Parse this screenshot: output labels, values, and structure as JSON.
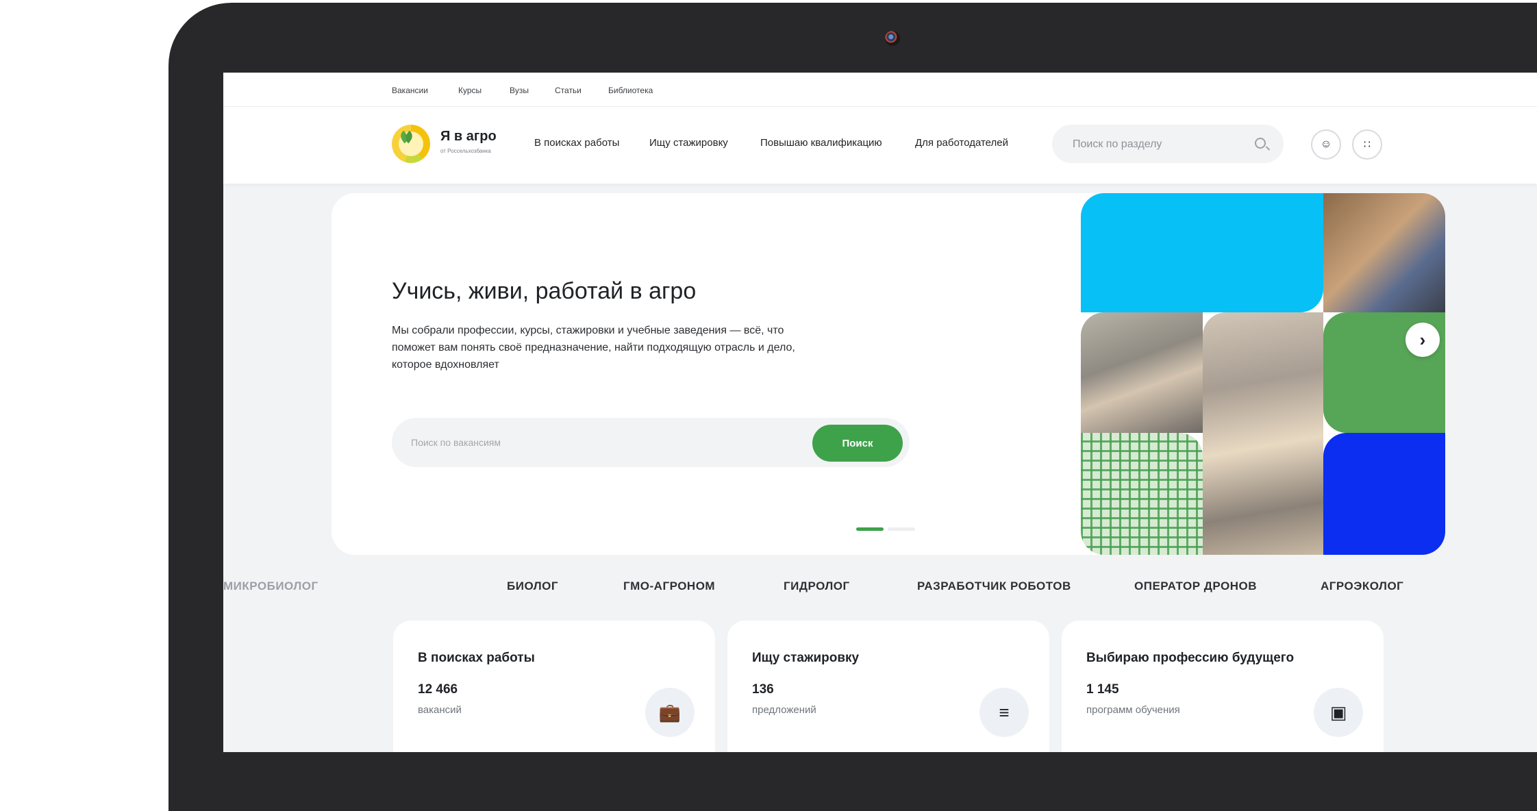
{
  "top_nav": [
    "Вакансии",
    "Курсы",
    "Вузы",
    "Статьи",
    "Библиотека"
  ],
  "brand": {
    "title": "Я в агро",
    "subtitle": "от Россельхозбанка"
  },
  "main_nav": [
    "В поисках работы",
    "Ищу стажировку",
    "Повышаю квалификацию",
    "Для работодателей"
  ],
  "header_search": {
    "placeholder": "Поиск по разделу"
  },
  "hero": {
    "title": "Учись, живи, работай в агро",
    "description": "Мы собрали профессии, курсы, стажировки и учебные заведения — всё, что поможет вам понять своё предназначение, найти подходящую отрасль и дело, которое вдохновляет",
    "search_placeholder": "Поиск по вакансиям",
    "search_button": "Поиск",
    "slides_total": 2,
    "slide_active": 1
  },
  "professions": [
    "МИКРОБИОЛОГ",
    "БИОЛОГ",
    "ГМО-АГРОНОМ",
    "ГИДРОЛОГ",
    "РАЗРАБОТЧИК РОБОТОВ",
    "ОПЕРАТОР ДРОНОВ",
    "АГРОЭКОЛОГ"
  ],
  "cards": [
    {
      "title": "В поисках работы",
      "count": "12 466",
      "unit": "вакансий",
      "icon": "briefcase-icon"
    },
    {
      "title": "Ищу стажировку",
      "count": "136",
      "unit": "предложений",
      "icon": "list-search-icon"
    },
    {
      "title": "Выбираю профессию будущего",
      "count": "1 145",
      "unit": "программ обучения",
      "icon": "chip-icon"
    }
  ],
  "colors": {
    "accent": "#3ea24b",
    "cyan": "#07c0f6",
    "green": "#57a557",
    "blue": "#0b2ef0",
    "bezel": "#28282b"
  }
}
